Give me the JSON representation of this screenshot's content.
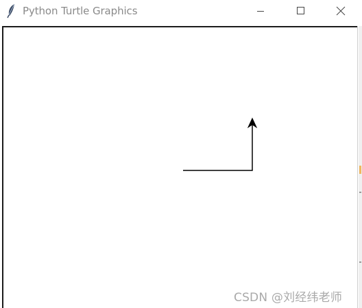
{
  "window": {
    "title": "Python Turtle Graphics",
    "icon": "feather-icon",
    "controls": {
      "minimize": "minimize-icon",
      "maximize": "maximize-icon",
      "close": "close-icon"
    }
  },
  "canvas": {
    "background": "#ffffff",
    "pen_color": "#000000",
    "turtle_shape": "arrow",
    "turtle_heading": "up"
  },
  "watermark": {
    "text": "CSDN @刘经纬老师"
  },
  "colors": {
    "title_text": "#8a8a8a",
    "accent_edge": "#f0b860"
  }
}
